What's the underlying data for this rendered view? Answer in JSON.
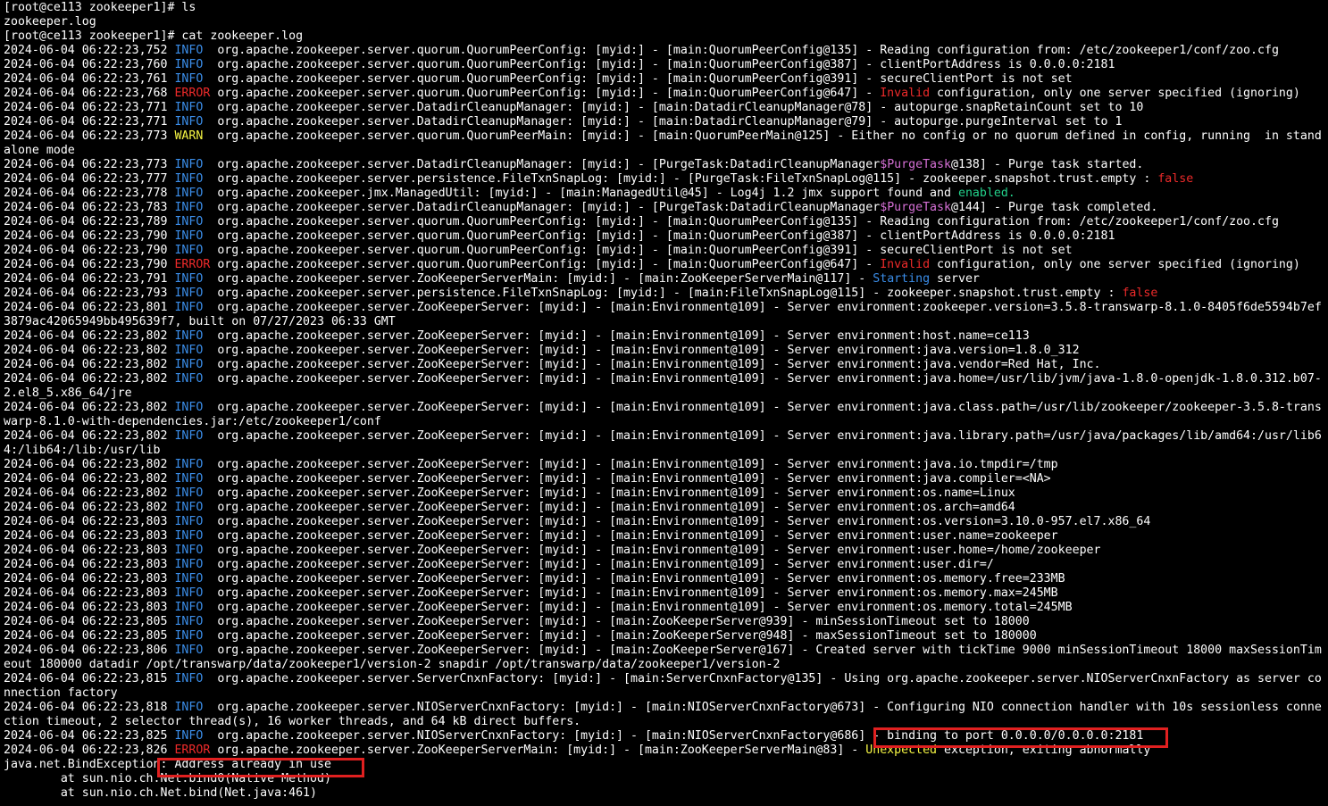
{
  "colors": {
    "background": "#000000",
    "default_text": "#ffffff",
    "info": "#3b8eea",
    "error": "#ee2a2a",
    "warn": "#f5f543",
    "enabled": "#23d18b",
    "purge_task": "#d670d6",
    "highlight_box": "#e02020"
  },
  "terminal": {
    "lines": [
      [
        {
          "t": "[root@ce113 zookeeper1]# ls"
        }
      ],
      [
        {
          "t": "zookeeper.log"
        }
      ],
      [
        {
          "t": "[root@ce113 zookeeper1]# cat zookeeper.log"
        }
      ],
      [
        {
          "t": "2024-06-04 06:22:23,752 "
        },
        {
          "t": "INFO",
          "c": "info"
        },
        {
          "t": "  org.apache.zookeeper.server.quorum.QuorumPeerConfig: [myid:] - [main:QuorumPeerConfig@135] - Reading configuration from: /etc/zookeeper1/conf/zoo.cfg"
        }
      ],
      [
        {
          "t": "2024-06-04 06:22:23,760 "
        },
        {
          "t": "INFO",
          "c": "info"
        },
        {
          "t": "  org.apache.zookeeper.server.quorum.QuorumPeerConfig: [myid:] - [main:QuorumPeerConfig@387] - clientPortAddress is 0.0.0.0:2181"
        }
      ],
      [
        {
          "t": "2024-06-04 06:22:23,761 "
        },
        {
          "t": "INFO",
          "c": "info"
        },
        {
          "t": "  org.apache.zookeeper.server.quorum.QuorumPeerConfig: [myid:] - [main:QuorumPeerConfig@391] - secureClientPort is not set"
        }
      ],
      [
        {
          "t": "2024-06-04 06:22:23,768 "
        },
        {
          "t": "ERROR",
          "c": "error"
        },
        {
          "t": " org.apache.zookeeper.server.quorum.QuorumPeerConfig: [myid:] - [main:QuorumPeerConfig@647] - "
        },
        {
          "t": "Invalid",
          "c": "red"
        },
        {
          "t": " configuration, only one server specified (ignoring)"
        }
      ],
      [
        {
          "t": "2024-06-04 06:22:23,771 "
        },
        {
          "t": "INFO",
          "c": "info"
        },
        {
          "t": "  org.apache.zookeeper.server.DatadirCleanupManager: [myid:] - [main:DatadirCleanupManager@78] - autopurge.snapRetainCount set to 10"
        }
      ],
      [
        {
          "t": "2024-06-04 06:22:23,771 "
        },
        {
          "t": "INFO",
          "c": "info"
        },
        {
          "t": "  org.apache.zookeeper.server.DatadirCleanupManager: [myid:] - [main:DatadirCleanupManager@79] - autopurge.purgeInterval set to 1"
        }
      ],
      [
        {
          "t": "2024-06-04 06:22:23,773 "
        },
        {
          "t": "WARN",
          "c": "warn"
        },
        {
          "t": "  org.apache.zookeeper.server.quorum.QuorumPeerMain: [myid:] - [main:QuorumPeerMain@125] - Either no config or no quorum defined in config, running  in stand"
        }
      ],
      [
        {
          "t": "alone mode"
        }
      ],
      [
        {
          "t": "2024-06-04 06:22:23,773 "
        },
        {
          "t": "INFO",
          "c": "info"
        },
        {
          "t": "  org.apache.zookeeper.server.DatadirCleanupManager: [myid:] - [PurgeTask:DatadirCleanupManager"
        },
        {
          "t": "$PurgeTask",
          "c": "magenta"
        },
        {
          "t": "@138] - Purge task started."
        }
      ],
      [
        {
          "t": "2024-06-04 06:22:23,777 "
        },
        {
          "t": "INFO",
          "c": "info"
        },
        {
          "t": "  org.apache.zookeeper.server.persistence.FileTxnSnapLog: [myid:] - [PurgeTask:FileTxnSnapLog@115] - zookeeper.snapshot.trust.empty : "
        },
        {
          "t": "false",
          "c": "red"
        }
      ],
      [
        {
          "t": "2024-06-04 06:22:23,778 "
        },
        {
          "t": "INFO",
          "c": "info"
        },
        {
          "t": "  org.apache.zookeeper.jmx.ManagedUtil: [myid:] - [main:ManagedUtil@45] - Log4j 1.2 jmx support found and "
        },
        {
          "t": "enabled.",
          "c": "green"
        }
      ],
      [
        {
          "t": "2024-06-04 06:22:23,783 "
        },
        {
          "t": "INFO",
          "c": "info"
        },
        {
          "t": "  org.apache.zookeeper.server.DatadirCleanupManager: [myid:] - [PurgeTask:DatadirCleanupManager"
        },
        {
          "t": "$PurgeTask",
          "c": "magenta"
        },
        {
          "t": "@144] - Purge task completed."
        }
      ],
      [
        {
          "t": "2024-06-04 06:22:23,789 "
        },
        {
          "t": "INFO",
          "c": "info"
        },
        {
          "t": "  org.apache.zookeeper.server.quorum.QuorumPeerConfig: [myid:] - [main:QuorumPeerConfig@135] - Reading configuration from: /etc/zookeeper1/conf/zoo.cfg"
        }
      ],
      [
        {
          "t": "2024-06-04 06:22:23,790 "
        },
        {
          "t": "INFO",
          "c": "info"
        },
        {
          "t": "  org.apache.zookeeper.server.quorum.QuorumPeerConfig: [myid:] - [main:QuorumPeerConfig@387] - clientPortAddress is 0.0.0.0:2181"
        }
      ],
      [
        {
          "t": "2024-06-04 06:22:23,790 "
        },
        {
          "t": "INFO",
          "c": "info"
        },
        {
          "t": "  org.apache.zookeeper.server.quorum.QuorumPeerConfig: [myid:] - [main:QuorumPeerConfig@391] - secureClientPort is not set"
        }
      ],
      [
        {
          "t": "2024-06-04 06:22:23,790 "
        },
        {
          "t": "ERROR",
          "c": "error"
        },
        {
          "t": " org.apache.zookeeper.server.quorum.QuorumPeerConfig: [myid:] - [main:QuorumPeerConfig@647] - "
        },
        {
          "t": "Invalid",
          "c": "red"
        },
        {
          "t": " configuration, only one server specified (ignoring)"
        }
      ],
      [
        {
          "t": "2024-06-04 06:22:23,791 "
        },
        {
          "t": "INFO",
          "c": "info"
        },
        {
          "t": "  org.apache.zookeeper.server.ZooKeeperServerMain: [myid:] - [main:ZooKeeperServerMain@117] - "
        },
        {
          "t": "Starting",
          "c": "blue"
        },
        {
          "t": " server"
        }
      ],
      [
        {
          "t": "2024-06-04 06:22:23,793 "
        },
        {
          "t": "INFO",
          "c": "info"
        },
        {
          "t": "  org.apache.zookeeper.server.persistence.FileTxnSnapLog: [myid:] - [main:FileTxnSnapLog@115] - zookeeper.snapshot.trust.empty : "
        },
        {
          "t": "false",
          "c": "red"
        }
      ],
      [
        {
          "t": "2024-06-04 06:22:23,801 "
        },
        {
          "t": "INFO",
          "c": "info"
        },
        {
          "t": "  org.apache.zookeeper.server.ZooKeeperServer: [myid:] - [main:Environment@109] - Server environment:zookeeper.version=3.5.8-transwarp-8.1.0-8405f6de5594b7ef"
        }
      ],
      [
        {
          "t": "3879ac42065949bb495639f7, built on 07/27/2023 06:33 GMT"
        }
      ],
      [
        {
          "t": "2024-06-04 06:22:23,802 "
        },
        {
          "t": "INFO",
          "c": "info"
        },
        {
          "t": "  org.apache.zookeeper.server.ZooKeeperServer: [myid:] - [main:Environment@109] - Server environment:host.name=ce113"
        }
      ],
      [
        {
          "t": "2024-06-04 06:22:23,802 "
        },
        {
          "t": "INFO",
          "c": "info"
        },
        {
          "t": "  org.apache.zookeeper.server.ZooKeeperServer: [myid:] - [main:Environment@109] - Server environment:java.version=1.8.0_312"
        }
      ],
      [
        {
          "t": "2024-06-04 06:22:23,802 "
        },
        {
          "t": "INFO",
          "c": "info"
        },
        {
          "t": "  org.apache.zookeeper.server.ZooKeeperServer: [myid:] - [main:Environment@109] - Server environment:java.vendor=Red Hat, Inc."
        }
      ],
      [
        {
          "t": "2024-06-04 06:22:23,802 "
        },
        {
          "t": "INFO",
          "c": "info"
        },
        {
          "t": "  org.apache.zookeeper.server.ZooKeeperServer: [myid:] - [main:Environment@109] - Server environment:java.home=/usr/lib/jvm/java-1.8.0-openjdk-1.8.0.312.b07-"
        }
      ],
      [
        {
          "t": "2.el8_5.x86_64/jre"
        }
      ],
      [
        {
          "t": "2024-06-04 06:22:23,802 "
        },
        {
          "t": "INFO",
          "c": "info"
        },
        {
          "t": "  org.apache.zookeeper.server.ZooKeeperServer: [myid:] - [main:Environment@109] - Server environment:java.class.path=/usr/lib/zookeeper/zookeeper-3.5.8-trans"
        }
      ],
      [
        {
          "t": "warp-8.1.0-with-dependencies.jar:/etc/zookeeper1/conf"
        }
      ],
      [
        {
          "t": "2024-06-04 06:22:23,802 "
        },
        {
          "t": "INFO",
          "c": "info"
        },
        {
          "t": "  org.apache.zookeeper.server.ZooKeeperServer: [myid:] - [main:Environment@109] - Server environment:java.library.path=/usr/java/packages/lib/amd64:/usr/lib6"
        }
      ],
      [
        {
          "t": "4:/lib64:/lib:/usr/lib"
        }
      ],
      [
        {
          "t": "2024-06-04 06:22:23,802 "
        },
        {
          "t": "INFO",
          "c": "info"
        },
        {
          "t": "  org.apache.zookeeper.server.ZooKeeperServer: [myid:] - [main:Environment@109] - Server environment:java.io.tmpdir=/tmp"
        }
      ],
      [
        {
          "t": "2024-06-04 06:22:23,802 "
        },
        {
          "t": "INFO",
          "c": "info"
        },
        {
          "t": "  org.apache.zookeeper.server.ZooKeeperServer: [myid:] - [main:Environment@109] - Server environment:java.compiler=<NA>"
        }
      ],
      [
        {
          "t": "2024-06-04 06:22:23,802 "
        },
        {
          "t": "INFO",
          "c": "info"
        },
        {
          "t": "  org.apache.zookeeper.server.ZooKeeperServer: [myid:] - [main:Environment@109] - Server environment:os.name=Linux"
        }
      ],
      [
        {
          "t": "2024-06-04 06:22:23,802 "
        },
        {
          "t": "INFO",
          "c": "info"
        },
        {
          "t": "  org.apache.zookeeper.server.ZooKeeperServer: [myid:] - [main:Environment@109] - Server environment:os.arch=amd64"
        }
      ],
      [
        {
          "t": "2024-06-04 06:22:23,803 "
        },
        {
          "t": "INFO",
          "c": "info"
        },
        {
          "t": "  org.apache.zookeeper.server.ZooKeeperServer: [myid:] - [main:Environment@109] - Server environment:os.version=3.10.0-957.el7.x86_64"
        }
      ],
      [
        {
          "t": "2024-06-04 06:22:23,803 "
        },
        {
          "t": "INFO",
          "c": "info"
        },
        {
          "t": "  org.apache.zookeeper.server.ZooKeeperServer: [myid:] - [main:Environment@109] - Server environment:user.name=zookeeper"
        }
      ],
      [
        {
          "t": "2024-06-04 06:22:23,803 "
        },
        {
          "t": "INFO",
          "c": "info"
        },
        {
          "t": "  org.apache.zookeeper.server.ZooKeeperServer: [myid:] - [main:Environment@109] - Server environment:user.home=/home/zookeeper"
        }
      ],
      [
        {
          "t": "2024-06-04 06:22:23,803 "
        },
        {
          "t": "INFO",
          "c": "info"
        },
        {
          "t": "  org.apache.zookeeper.server.ZooKeeperServer: [myid:] - [main:Environment@109] - Server environment:user.dir=/"
        }
      ],
      [
        {
          "t": "2024-06-04 06:22:23,803 "
        },
        {
          "t": "INFO",
          "c": "info"
        },
        {
          "t": "  org.apache.zookeeper.server.ZooKeeperServer: [myid:] - [main:Environment@109] - Server environment:os.memory.free=233MB"
        }
      ],
      [
        {
          "t": "2024-06-04 06:22:23,803 "
        },
        {
          "t": "INFO",
          "c": "info"
        },
        {
          "t": "  org.apache.zookeeper.server.ZooKeeperServer: [myid:] - [main:Environment@109] - Server environment:os.memory.max=245MB"
        }
      ],
      [
        {
          "t": "2024-06-04 06:22:23,803 "
        },
        {
          "t": "INFO",
          "c": "info"
        },
        {
          "t": "  org.apache.zookeeper.server.ZooKeeperServer: [myid:] - [main:Environment@109] - Server environment:os.memory.total=245MB"
        }
      ],
      [
        {
          "t": "2024-06-04 06:22:23,805 "
        },
        {
          "t": "INFO",
          "c": "info"
        },
        {
          "t": "  org.apache.zookeeper.server.ZooKeeperServer: [myid:] - [main:ZooKeeperServer@939] - minSessionTimeout set to 18000"
        }
      ],
      [
        {
          "t": "2024-06-04 06:22:23,805 "
        },
        {
          "t": "INFO",
          "c": "info"
        },
        {
          "t": "  org.apache.zookeeper.server.ZooKeeperServer: [myid:] - [main:ZooKeeperServer@948] - maxSessionTimeout set to 180000"
        }
      ],
      [
        {
          "t": "2024-06-04 06:22:23,806 "
        },
        {
          "t": "INFO",
          "c": "info"
        },
        {
          "t": "  org.apache.zookeeper.server.ZooKeeperServer: [myid:] - [main:ZooKeeperServer@167] - Created server with tickTime 9000 minSessionTimeout 18000 maxSessionTim"
        }
      ],
      [
        {
          "t": "eout 180000 datadir /opt/transwarp/data/zookeeper1/version-2 snapdir /opt/transwarp/data/zookeeper1/version-2"
        }
      ],
      [
        {
          "t": "2024-06-04 06:22:23,815 "
        },
        {
          "t": "INFO",
          "c": "info"
        },
        {
          "t": "  org.apache.zookeeper.server.ServerCnxnFactory: [myid:] - [main:ServerCnxnFactory@135] - Using org.apache.zookeeper.server.NIOServerCnxnFactory as server co"
        }
      ],
      [
        {
          "t": "nnection factory"
        }
      ],
      [
        {
          "t": "2024-06-04 06:22:23,818 "
        },
        {
          "t": "INFO",
          "c": "info"
        },
        {
          "t": "  org.apache.zookeeper.server.NIOServerCnxnFactory: [myid:] - [main:NIOServerCnxnFactory@673] - Configuring NIO connection handler with 10s sessionless conne"
        }
      ],
      [
        {
          "t": "ction timeout, 2 selector thread(s), 16 worker threads, and 64 kB direct buffers."
        }
      ],
      [
        {
          "t": "2024-06-04 06:22:23,825 "
        },
        {
          "t": "INFO",
          "c": "info"
        },
        {
          "t": "  org.apache.zookeeper.server.NIOServerCnxnFactory: [myid:] - [main:NIOServerCnxnFactory@686] - binding to port 0.0.0.0/0.0.0.0:2181"
        }
      ],
      [
        {
          "t": "2024-06-04 06:22:23,826 "
        },
        {
          "t": "ERROR",
          "c": "error"
        },
        {
          "t": " org.apache.zookeeper.server.ZooKeeperServerMain: [myid:] - [main:ZooKeeperServerMain@83] - "
        },
        {
          "t": "Unexpected",
          "c": "yellow"
        },
        {
          "t": " exception, exiting abnormally"
        }
      ],
      [
        {
          "t": "java.net.BindException: Address already in use"
        }
      ],
      [
        {
          "t": "        at sun.nio.ch.Net.bind0(Native Method)"
        }
      ],
      [
        {
          "t": "        at sun.nio.ch.Net.bind(Net.java:461)"
        }
      ]
    ]
  }
}
